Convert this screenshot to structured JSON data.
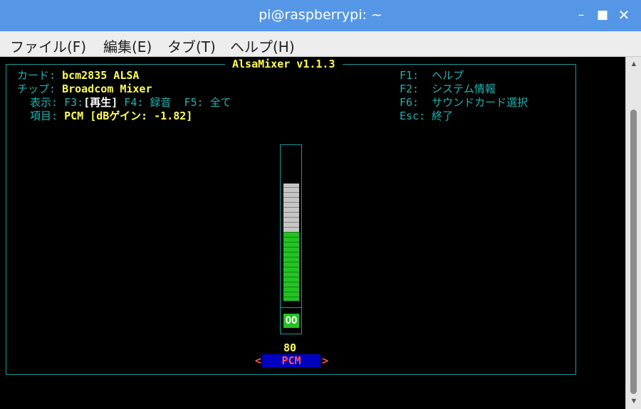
{
  "window": {
    "title": "pi@raspberrypi: ~",
    "minimize_icon": "minimize-icon",
    "maximize_icon": "maximize-icon",
    "close_icon": "close-icon"
  },
  "menu": {
    "items": [
      "ファイル(F)",
      "編集(E)",
      "タブ(T)",
      "ヘルプ(H)"
    ]
  },
  "mixer": {
    "title": "AlsaMixer v1.1.3",
    "card_label": "カード: ",
    "card_value": "bcm2835 ALSA",
    "chip_label": "チップ: ",
    "chip_value": "Broadcom Mixer",
    "view_label": "  表示: ",
    "view_f3": "F3:",
    "view_f3_value": "[再生]",
    "view_f4": " F4: 録音  F5: 全て",
    "item_label": "  項目: ",
    "item_value": "PCM [dBゲイン: -1.82]",
    "help": [
      "F1:  ヘルプ",
      "F2:  システム情報",
      "F6:  サウンドカード選択",
      "Esc: 終了"
    ],
    "control": {
      "name": "PCM",
      "volume_text": "80",
      "volume_fraction": 0.56,
      "mute_text": "OO",
      "left_arrow": "<",
      "right_arrow": ">"
    }
  },
  "colors": {
    "titlebar": "#5597e6",
    "terminal_bg": "#000000",
    "frame_cyan": "#1a9a9a",
    "text_yellow": "#ffff55",
    "bar_green": "#22c322",
    "bar_empty": "#c6c6c6",
    "name_bg": "#0000c0",
    "name_red": "#ff5555"
  }
}
